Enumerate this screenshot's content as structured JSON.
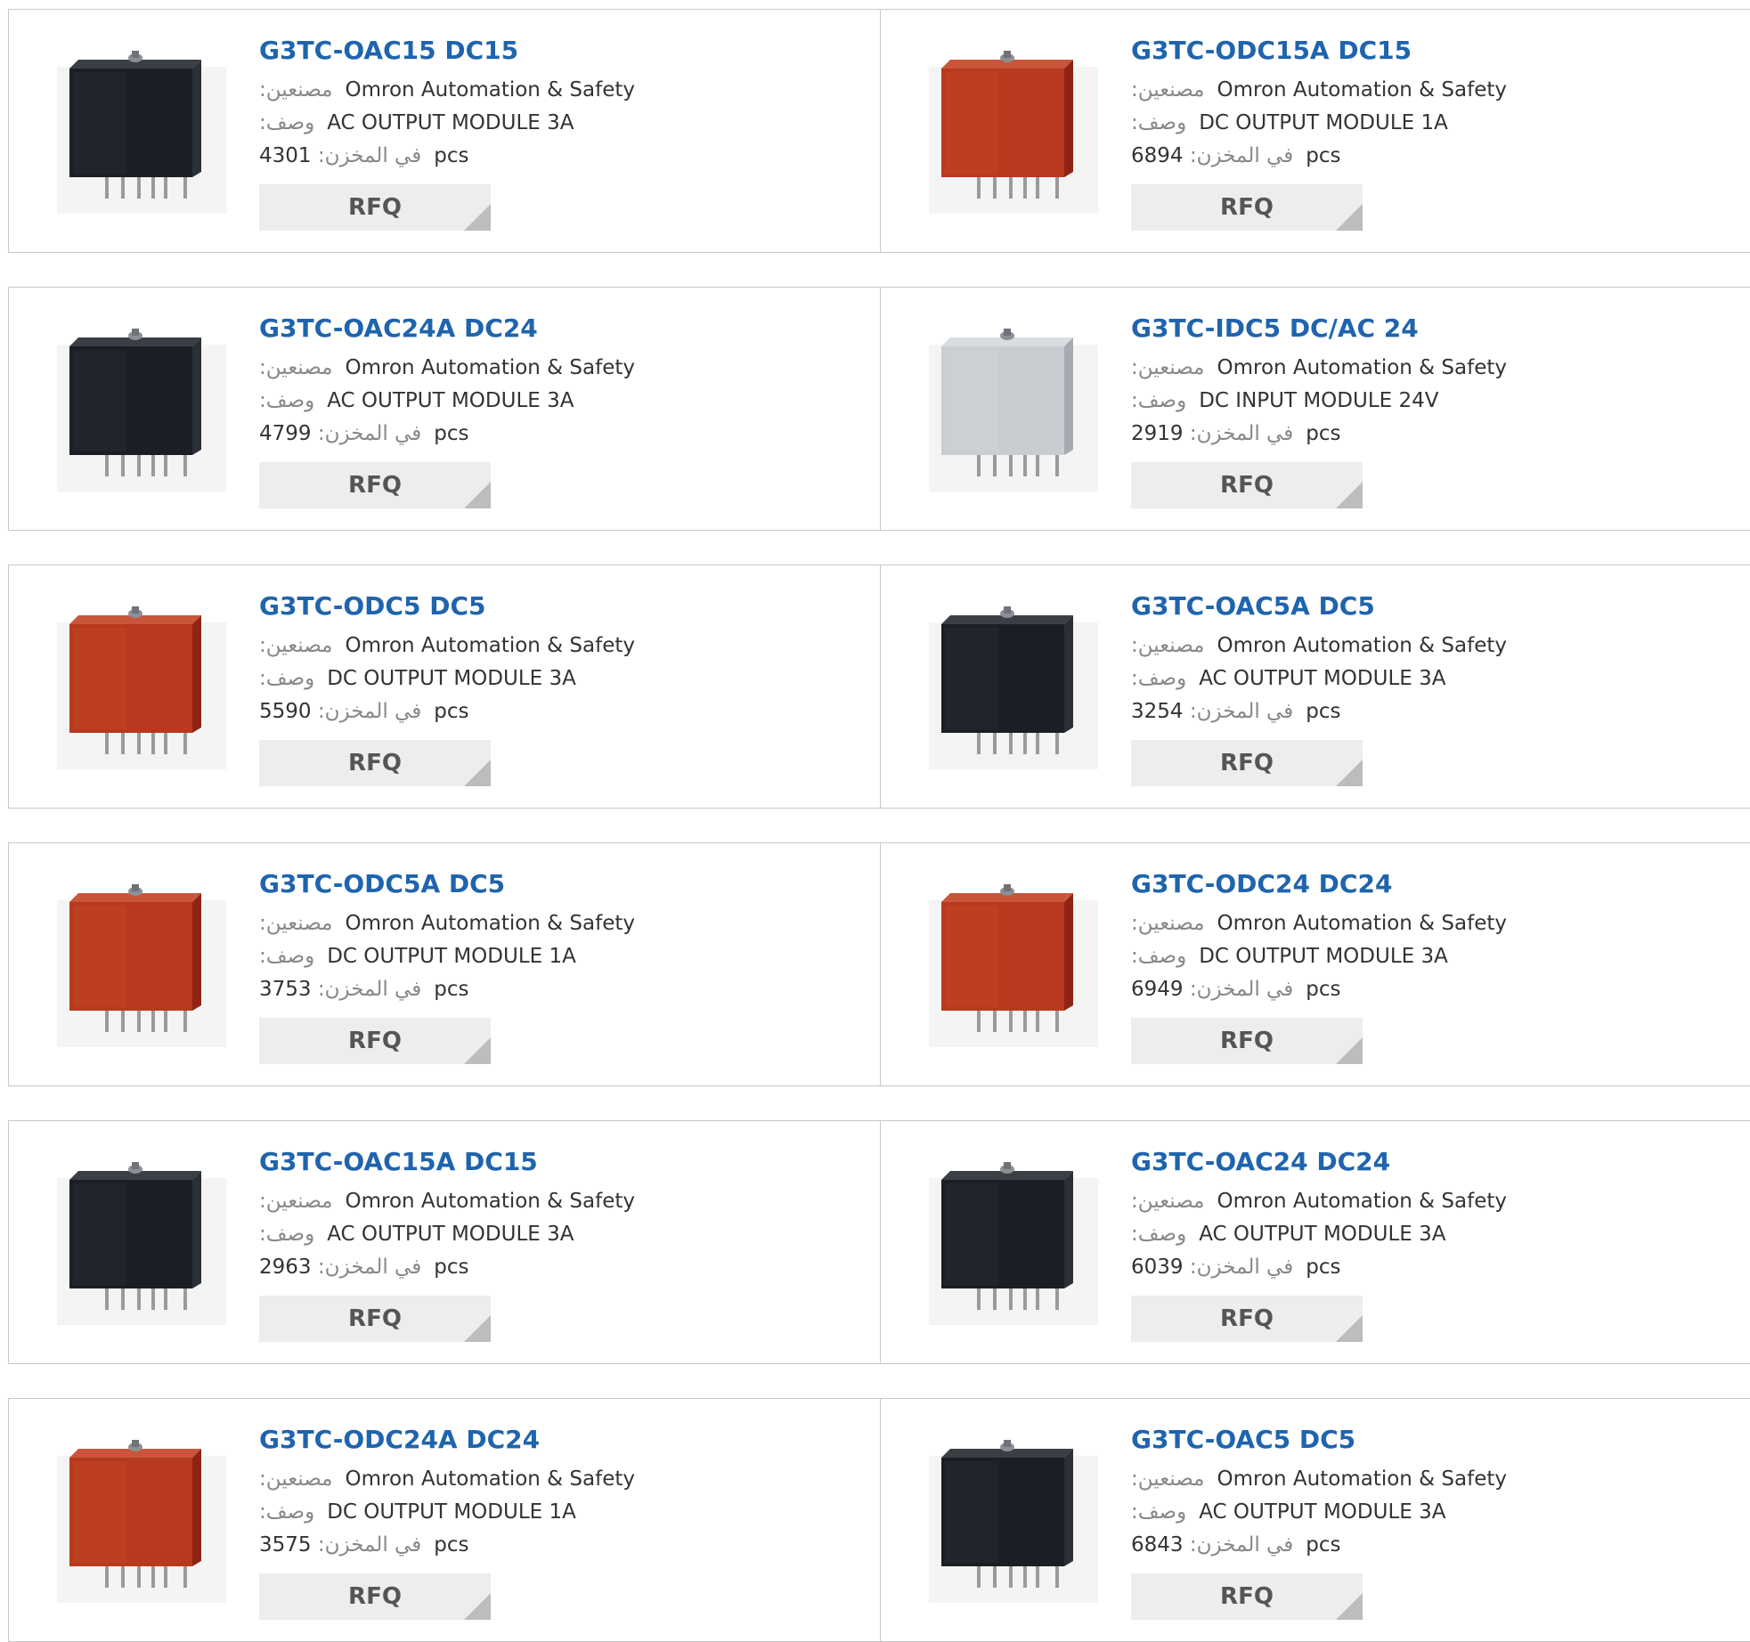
{
  "labels": {
    "manufacturer": "مصنعين:",
    "description": "وصف:",
    "stock": "في المخزن:",
    "unit": "pcs",
    "rfq": "RFQ"
  },
  "colors": {
    "title": "#1f64ad",
    "black_module": "#1b1e24",
    "red_module": "#b8391e",
    "gray_module": "#c9ccd1"
  },
  "products": [
    {
      "title": "G3TC-OAC15 DC15",
      "manufacturer": "Omron Automation & Safety",
      "description": "AC OUTPUT MODULE 3A",
      "stock": "4301",
      "image": "black-module-icon"
    },
    {
      "title": "G3TC-ODC15A DC15",
      "manufacturer": "Omron Automation & Safety",
      "description": "DC OUTPUT MODULE 1A",
      "stock": "6894",
      "image": "red-module-icon"
    },
    {
      "title": "G3TC-OAC24A DC24",
      "manufacturer": "Omron Automation & Safety",
      "description": "AC OUTPUT MODULE 3A",
      "stock": "4799",
      "image": "black-module-icon"
    },
    {
      "title": "G3TC-IDC5 DC/AC 24",
      "manufacturer": "Omron Automation & Safety",
      "description": "DC INPUT MODULE 24V",
      "stock": "2919",
      "image": "gray-module-icon"
    },
    {
      "title": "G3TC-ODC5 DC5",
      "manufacturer": "Omron Automation & Safety",
      "description": "DC OUTPUT MODULE 3A",
      "stock": "5590",
      "image": "red-module-icon"
    },
    {
      "title": "G3TC-OAC5A DC5",
      "manufacturer": "Omron Automation & Safety",
      "description": "AC OUTPUT MODULE 3A",
      "stock": "3254",
      "image": "black-module-icon"
    },
    {
      "title": "G3TC-ODC5A DC5",
      "manufacturer": "Omron Automation & Safety",
      "description": "DC OUTPUT MODULE 1A",
      "stock": "3753",
      "image": "red-module-icon"
    },
    {
      "title": "G3TC-ODC24 DC24",
      "manufacturer": "Omron Automation & Safety",
      "description": "DC OUTPUT MODULE 3A",
      "stock": "6949",
      "image": "red-module-icon"
    },
    {
      "title": "G3TC-OAC15A DC15",
      "manufacturer": "Omron Automation & Safety",
      "description": "AC OUTPUT MODULE 3A",
      "stock": "2963",
      "image": "black-module-icon"
    },
    {
      "title": "G3TC-OAC24 DC24",
      "manufacturer": "Omron Automation & Safety",
      "description": "AC OUTPUT MODULE 3A",
      "stock": "6039",
      "image": "black-module-icon"
    },
    {
      "title": "G3TC-ODC24A DC24",
      "manufacturer": "Omron Automation & Safety",
      "description": "DC OUTPUT MODULE 1A",
      "stock": "3575",
      "image": "red-module-icon"
    },
    {
      "title": "G3TC-OAC5 DC5",
      "manufacturer": "Omron Automation & Safety",
      "description": "AC OUTPUT MODULE 3A",
      "stock": "6843",
      "image": "black-module-icon"
    }
  ]
}
